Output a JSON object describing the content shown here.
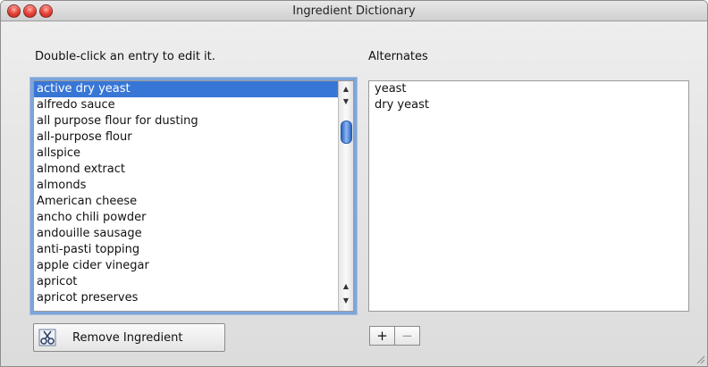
{
  "window": {
    "title": "Ingredient Dictionary"
  },
  "instruction": "Double-click an entry to edit it.",
  "alternates_title": "Alternates",
  "ingredients": [
    "active dry yeast",
    "alfredo sauce",
    "all purpose flour for dusting",
    "all-purpose flour",
    "allspice",
    "almond extract",
    "almonds",
    "American cheese",
    "ancho chili powder",
    "andouille sausage",
    "anti-pasti topping",
    "apple cider vinegar",
    "apricot",
    "apricot preserves"
  ],
  "selected_ingredient": "active dry yeast",
  "alternates": [
    "yeast",
    "dry yeast"
  ],
  "buttons": {
    "remove": "Remove Ingredient",
    "add": "+",
    "remove_alt": "−"
  },
  "colors": {
    "selection": "#3876d6",
    "focus_ring": "#7ea6d8"
  }
}
